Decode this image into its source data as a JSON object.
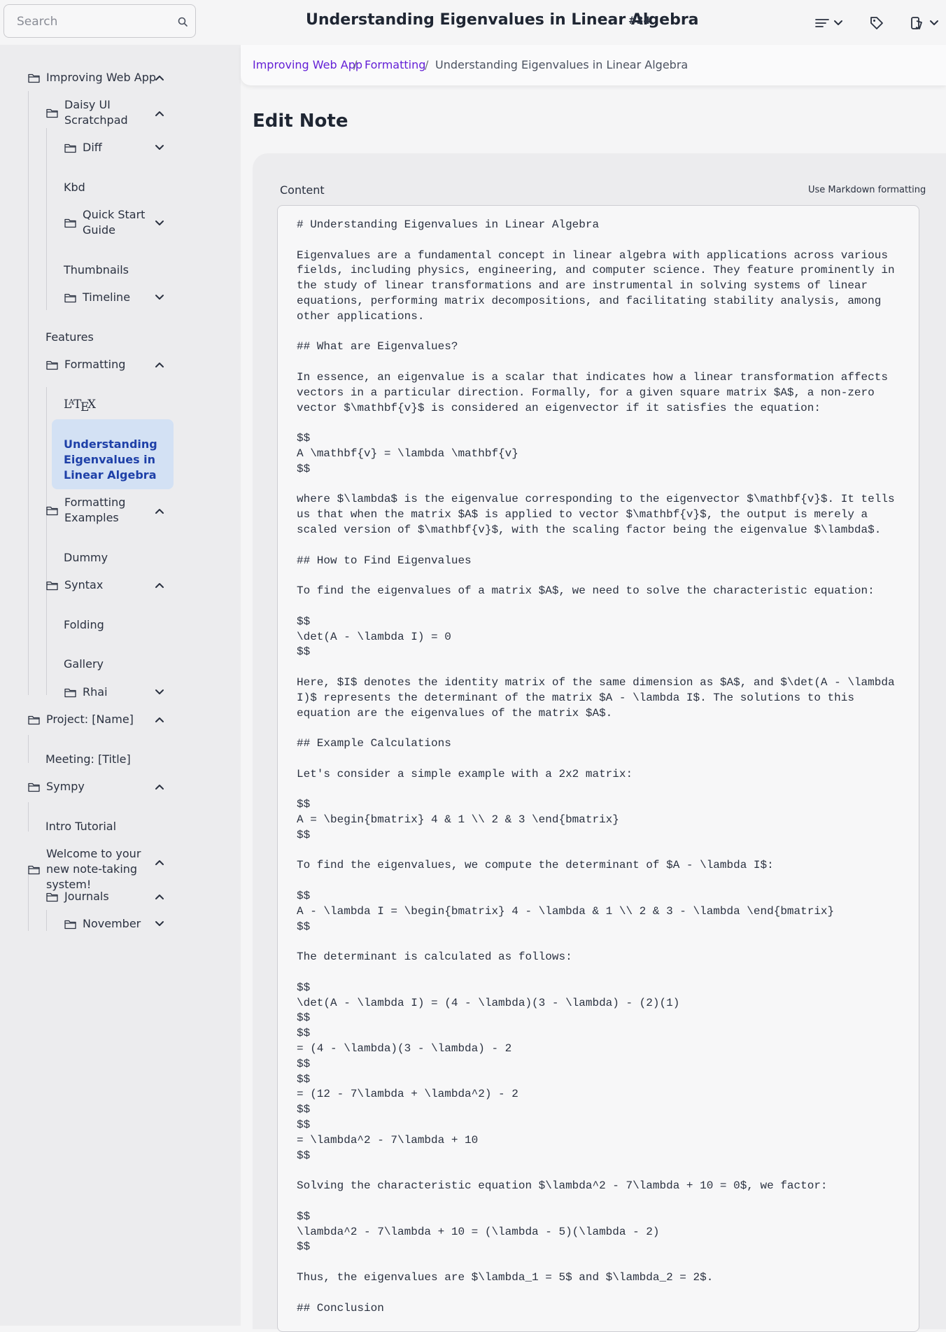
{
  "search": {
    "placeholder": "Search"
  },
  "header": {
    "title": "Understanding Eigenvalues in Linear Algebra",
    "note_id": "#34"
  },
  "sidebar": {
    "items": [
      {
        "label": "Improving Web App",
        "icon": "folder-icon",
        "expanded": true
      },
      {
        "label": "Daisy UI Scratchpad",
        "icon": "folder-icon",
        "expanded": true
      },
      {
        "label": "Diff",
        "icon": "folder-icon",
        "expanded": false
      },
      {
        "label": "Kbd"
      },
      {
        "label": "Quick Start Guide",
        "icon": "folder-icon",
        "expanded": false
      },
      {
        "label": "Thumbnails"
      },
      {
        "label": "Timeline",
        "icon": "folder-icon",
        "expanded": false
      },
      {
        "label": "Features"
      },
      {
        "label": "Formatting",
        "icon": "folder-icon",
        "expanded": true
      },
      {
        "label": "LaTeX",
        "logo": "latex-logo"
      },
      {
        "label": "Understanding Eigenvalues in Linear Algebra",
        "active": true
      },
      {
        "label": "Formatting Examples",
        "icon": "folder-icon",
        "expanded": true
      },
      {
        "label": "Dummy"
      },
      {
        "label": "Syntax",
        "icon": "folder-icon",
        "expanded": true
      },
      {
        "label": "Folding"
      },
      {
        "label": "Gallery"
      },
      {
        "label": "Rhai",
        "icon": "folder-icon",
        "expanded": false
      },
      {
        "label": "Project: [Name]",
        "icon": "folder-icon",
        "expanded": true
      },
      {
        "label": "Meeting: [Title]"
      },
      {
        "label": "Sympy",
        "icon": "folder-icon",
        "expanded": true
      },
      {
        "label": "Intro Tutorial"
      },
      {
        "label": "Welcome to your new note-taking system!",
        "icon": "folder-icon",
        "expanded": true
      },
      {
        "label": "Journals",
        "icon": "folder-icon",
        "expanded": true
      },
      {
        "label": "November",
        "icon": "folder-icon",
        "expanded": false
      }
    ]
  },
  "breadcrumb": {
    "items": [
      "Improving Web App",
      "Formatting",
      "Understanding Eigenvalues in Linear Algebra"
    ],
    "separator": "/"
  },
  "main": {
    "page_title": "Edit Note",
    "content_label": "Content",
    "markdown_hint": "Use Markdown formatting",
    "editor_text": "# Understanding Eigenvalues in Linear Algebra\n\nEigenvalues are a fundamental concept in linear algebra with applications across various fields, including physics, engineering, and computer science. They feature prominently in the study of linear transformations and are instrumental in solving systems of linear equations, performing matrix decompositions, and facilitating stability analysis, among other applications.\n\n## What are Eigenvalues?\n\nIn essence, an eigenvalue is a scalar that indicates how a linear transformation affects vectors in a particular direction. Formally, for a given square matrix $A$, a non-zero vector $\\mathbf{v}$ is considered an eigenvector if it satisfies the equation:\n\n$$\nA \\mathbf{v} = \\lambda \\mathbf{v}\n$$\n\nwhere $\\lambda$ is the eigenvalue corresponding to the eigenvector $\\mathbf{v}$. It tells us that when the matrix $A$ is applied to vector $\\mathbf{v}$, the output is merely a scaled version of $\\mathbf{v}$, with the scaling factor being the eigenvalue $\\lambda$.\n\n## How to Find Eigenvalues\n\nTo find the eigenvalues of a matrix $A$, we need to solve the characteristic equation:\n\n$$\n\\det(A - \\lambda I) = 0\n$$\n\nHere, $I$ denotes the identity matrix of the same dimension as $A$, and $\\det(A - \\lambda I)$ represents the determinant of the matrix $A - \\lambda I$. The solutions to this equation are the eigenvalues of the matrix $A$.\n\n## Example Calculations\n\nLet's consider a simple example with a 2x2 matrix:\n\n$$\nA = \\begin{bmatrix} 4 & 1 \\\\ 2 & 3 \\end{bmatrix}\n$$\n\nTo find the eigenvalues, we compute the determinant of $A - \\lambda I$:\n\n$$\nA - \\lambda I = \\begin{bmatrix} 4 - \\lambda & 1 \\\\ 2 & 3 - \\lambda \\end{bmatrix}\n$$\n\nThe determinant is calculated as follows:\n\n$$\n\\det(A - \\lambda I) = (4 - \\lambda)(3 - \\lambda) - (2)(1)\n$$\n$$\n= (4 - \\lambda)(3 - \\lambda) - 2\n$$\n$$\n= (12 - 7\\lambda + \\lambda^2) - 2\n$$\n$$\n= \\lambda^2 - 7\\lambda + 10\n$$\n\nSolving the characteristic equation $\\lambda^2 - 7\\lambda + 10 = 0$, we factor:\n\n$$\n\\lambda^2 - 7\\lambda + 10 = (\\lambda - 5)(\\lambda - 2)\n$$\n\nThus, the eigenvalues are $\\lambda_1 = 5$ and $\\lambda_2 = 2$.\n\n## Conclusion"
  },
  "toolbar": {
    "icons": [
      "menu-lines-icon",
      "chevron-down-icon",
      "tag-icon",
      "theme-icon",
      "chevron-down-icon"
    ]
  },
  "colors": {
    "accent_link": "#6420d6",
    "active_bg": "#d3e1f4",
    "active_text": "#1e40a8"
  }
}
